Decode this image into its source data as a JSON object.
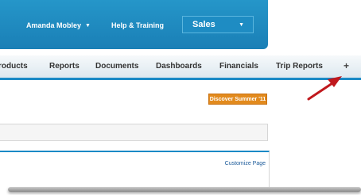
{
  "header": {
    "user_name": "Amanda Mobley",
    "help_label": "Help & Training",
    "app_name": "Sales",
    "caret_icon": "▼"
  },
  "tabs": [
    {
      "label": "roducts"
    },
    {
      "label": "Reports"
    },
    {
      "label": "Documents"
    },
    {
      "label": "Dashboards"
    },
    {
      "label": "Financials"
    },
    {
      "label": "Trip Reports"
    },
    {
      "label": "+"
    }
  ],
  "promo": {
    "label": "Discover Summer '11"
  },
  "panel": {
    "customize_label": "Customize Page"
  },
  "colors": {
    "header_blue": "#1a8ac6",
    "promo_orange": "#e28a1d",
    "arrow_red": "#c0181d"
  },
  "icons": {
    "user_dropdown": "chevron-down-icon",
    "app_dropdown": "chevron-down-icon",
    "all_tabs": "plus-icon",
    "annotation": "red-arrow-icon"
  }
}
